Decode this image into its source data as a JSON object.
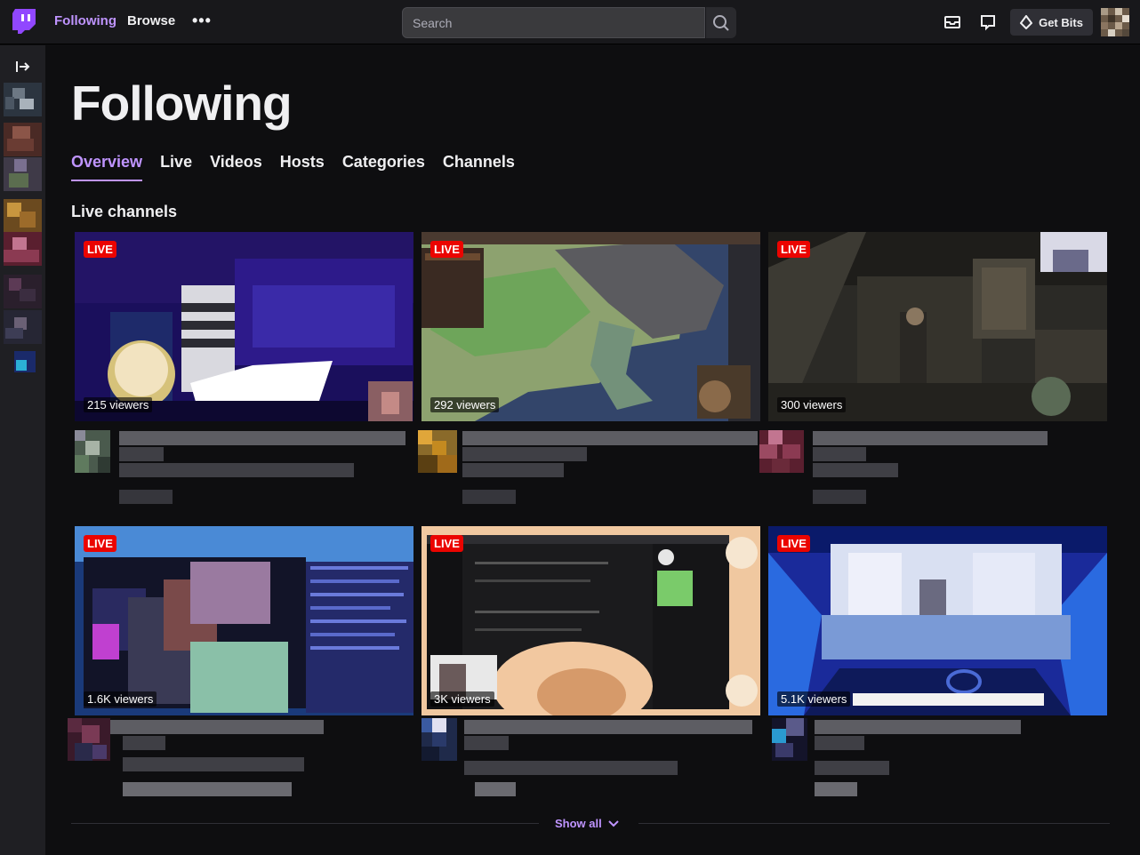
{
  "topnav": {
    "following_label": "Following",
    "browse_label": "Browse",
    "more_label": "•••",
    "search_placeholder": "Search",
    "get_bits_label": "Get Bits",
    "accent_color": "#9147ff"
  },
  "page": {
    "title": "Following",
    "tabs": [
      "Overview",
      "Live",
      "Videos",
      "Hosts",
      "Categories",
      "Channels"
    ],
    "active_tab": "Overview",
    "section_title": "Live channels",
    "show_all_label": "Show all"
  },
  "cards": [
    {
      "live_label": "LIVE",
      "viewers": "215 viewers"
    },
    {
      "live_label": "LIVE",
      "viewers": "292 viewers"
    },
    {
      "live_label": "LIVE",
      "viewers": "300 viewers"
    },
    {
      "live_label": "LIVE",
      "viewers": "1.6K viewers"
    },
    {
      "live_label": "LIVE",
      "viewers": "3K viewers"
    },
    {
      "live_label": "LIVE",
      "viewers": "5.1K viewers"
    }
  ],
  "colors": {
    "live_badge": "#eb0400",
    "active_tab": "#bf94ff",
    "background": "#0e0e10"
  }
}
